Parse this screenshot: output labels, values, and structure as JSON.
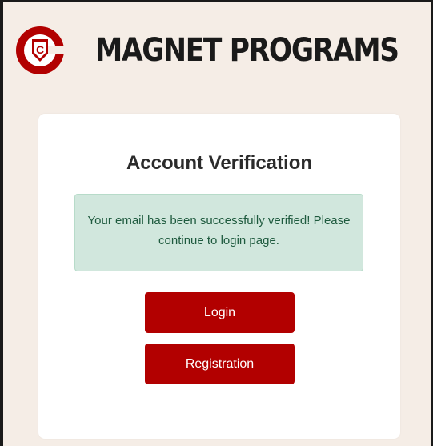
{
  "header": {
    "brand_title": "MAGNET PROGRAMS",
    "logo_icon": "c-badge-logo-icon"
  },
  "card": {
    "title": "Account Verification",
    "alert_message": "Your email has been successfully verified! Please continue to login page.",
    "login_label": "Login",
    "registration_label": "Registration"
  },
  "colors": {
    "brand_red": "#b20000",
    "page_background": "#f5ede6",
    "alert_background": "#d1e7dd",
    "alert_text": "#1e5a3e"
  }
}
